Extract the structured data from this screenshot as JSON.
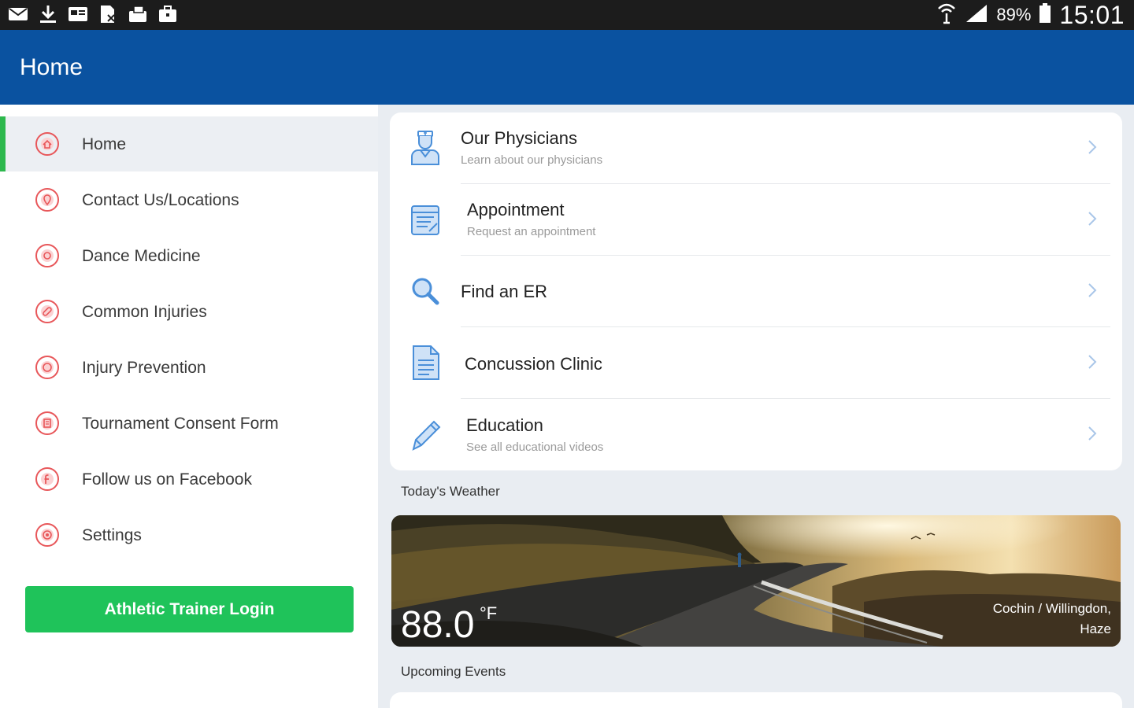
{
  "status_bar": {
    "battery": "89%",
    "time": "15:01"
  },
  "app_bar": {
    "title": "Home"
  },
  "sidebar": {
    "items": [
      {
        "label": "Home",
        "icon": "home-icon",
        "active": true
      },
      {
        "label": "Contact Us/Locations",
        "icon": "location-icon",
        "active": false
      },
      {
        "label": "Dance Medicine",
        "icon": "dance-icon",
        "active": false
      },
      {
        "label": "Common Injuries",
        "icon": "bandage-icon",
        "active": false
      },
      {
        "label": "Injury Prevention",
        "icon": "shield-icon",
        "active": false
      },
      {
        "label": "Tournament Consent Form",
        "icon": "form-icon",
        "active": false
      },
      {
        "label": "Follow us on Facebook",
        "icon": "facebook-icon",
        "active": false
      },
      {
        "label": "Settings",
        "icon": "settings-icon",
        "active": false
      }
    ],
    "login_button": "Athletic Trainer Login"
  },
  "menu": [
    {
      "title": "Our Physicians",
      "subtitle": "Learn about our physicians",
      "icon": "physician-icon"
    },
    {
      "title": "Appointment",
      "subtitle": "Request an appointment",
      "icon": "appointment-icon"
    },
    {
      "title": "Find an ER",
      "subtitle": "",
      "icon": "search-icon"
    },
    {
      "title": "Concussion Clinic",
      "subtitle": "",
      "icon": "document-icon"
    },
    {
      "title": "Education",
      "subtitle": "See all educational videos",
      "icon": "pencil-icon"
    }
  ],
  "weather": {
    "section_label": "Today's Weather",
    "temperature": "88.0",
    "unit": "°F",
    "location": "Cochin / Willingdon,",
    "condition": "Haze"
  },
  "events": {
    "section_label": "Upcoming Events"
  },
  "colors": {
    "app_bar": "#0a52a0",
    "accent_green": "#1fc35a",
    "nav_icon": "#e8575a",
    "menu_icon": "#4a8fd9"
  }
}
